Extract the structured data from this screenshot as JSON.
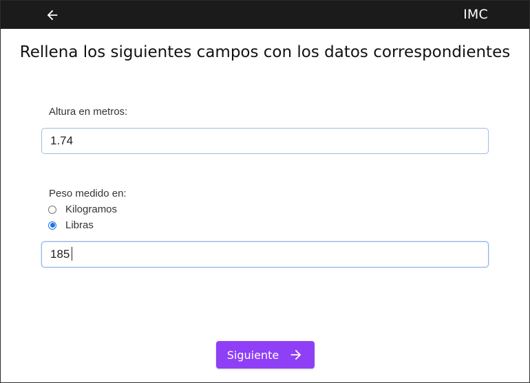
{
  "header": {
    "title": "IMC",
    "back_icon": "arrow-left-icon"
  },
  "form": {
    "heading": "Rellena los siguientes campos con los datos correspondientes",
    "height_label": "Altura en metros:",
    "height_value": "1.74",
    "weight_label": "Peso medido en:",
    "weight_units": [
      {
        "label": "Kilogramos",
        "checked": false
      },
      {
        "label": "Libras",
        "checked": true
      }
    ],
    "weight_value": "185"
  },
  "actions": {
    "next_label": "Siguiente",
    "next_icon": "arrow-right-icon",
    "accent_color": "#8f3ff5"
  }
}
